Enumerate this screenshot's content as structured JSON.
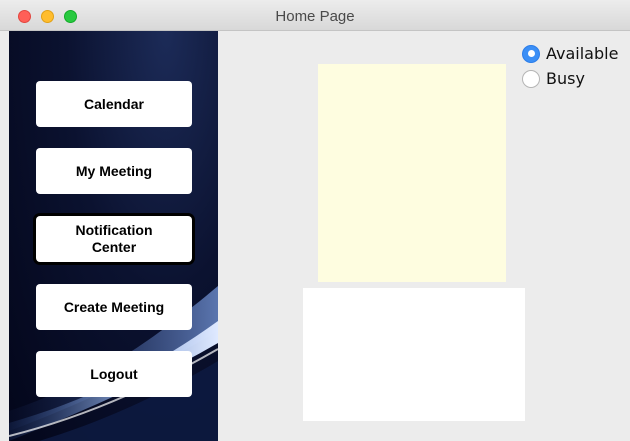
{
  "window": {
    "title": "Home Page"
  },
  "sidebar": {
    "buttons": [
      {
        "label": "Calendar"
      },
      {
        "label": "My Meeting"
      },
      {
        "label": "Notification\nCenter"
      },
      {
        "label": "Create Meeting"
      },
      {
        "label": "Logout"
      }
    ]
  },
  "status": {
    "options": [
      {
        "label": "Available",
        "selected": true
      },
      {
        "label": "Busy",
        "selected": false
      }
    ]
  },
  "colors": {
    "accent": "#3b8ff6",
    "yellow_panel": "#fefde0"
  }
}
